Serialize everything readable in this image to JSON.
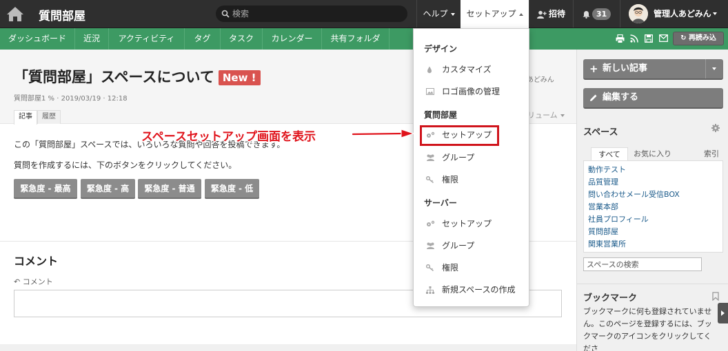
{
  "topbar": {
    "brand": "質問部屋",
    "search_placeholder": "検索",
    "help_label": "ヘルプ",
    "setup_label": "セットアップ",
    "invite_label": "招待",
    "notification_count": "31",
    "user_name": "管理人あどみん"
  },
  "greennav": {
    "items": [
      "ダッシュボード",
      "近況",
      "アクティビティ",
      "タグ",
      "タスク",
      "カレンダー",
      "共有フォルダ"
    ],
    "reload_label": "再読み込"
  },
  "article": {
    "title": "「質問部屋」スペースについて",
    "new_badge": "New !",
    "meta": "質問部屋1 % · 2019/03/19 · 12:18",
    "author_fragment": "あどみん",
    "volume_fragment": "リューム",
    "tabs": [
      "記事",
      "履歴"
    ],
    "para1": "この「質問部屋」スペースでは、いろいろな質問や回答を投稿できます。",
    "para2": "質問を作成するには、下のボタンをクリックしてください。",
    "urgency_buttons": [
      "緊急度 - 最高",
      "緊急度 - 高",
      "緊急度 - 普通",
      "緊急度 - 低"
    ]
  },
  "comment": {
    "heading": "コメント",
    "reply_label": "コメント"
  },
  "sidebar": {
    "new_article": "新しい記事",
    "edit": "編集する",
    "spaces_heading": "スペース",
    "tab_all": "すべて",
    "tab_favorites": "お気に入り",
    "index_label": "索引",
    "spaces": [
      "動作テスト",
      "品質管理",
      "問い合わせメール受信BOX",
      "営業本部",
      "社員プロフィール",
      "質問部屋",
      "関東営業所"
    ],
    "space_search_placeholder": "スペースの検索",
    "bookmark_heading": "ブックマーク",
    "bookmark_text": "ブックマークに何も登録されていません。このページを登録するには、ブックマークのアイコンをクリックしてくださ"
  },
  "dropdown": {
    "design_heading": "デザイン",
    "customize": "カスタマイズ",
    "logo_manage": "ロゴ画像の管理",
    "room_heading": "質問部屋",
    "room_setup": "セットアップ",
    "room_group": "グループ",
    "room_perm": "権限",
    "server_heading": "サーバー",
    "server_setup": "セットアップ",
    "server_group": "グループ",
    "server_perm": "権限",
    "new_space": "新規スペースの作成"
  },
  "annotation": {
    "text": "スペースセットアップ画面を表示"
  },
  "colors": {
    "topbar": "#2f2f2f",
    "green_nav": "#3d9a63",
    "new_badge": "#d9534f",
    "annotation_red": "#e0141c"
  }
}
